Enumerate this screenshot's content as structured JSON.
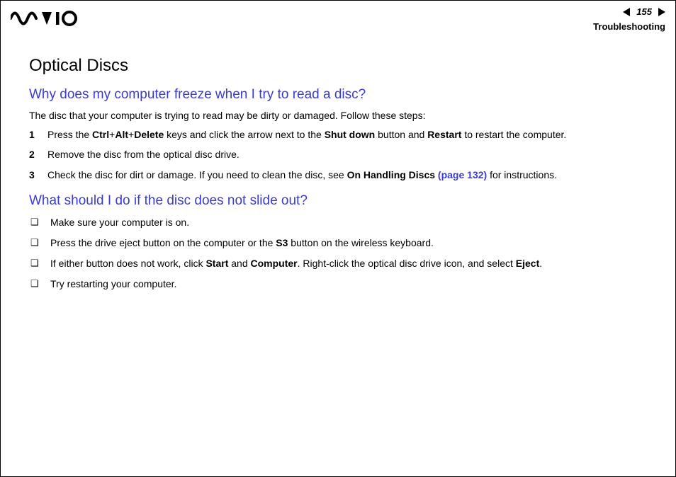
{
  "header": {
    "page_number": "155",
    "section": "Troubleshooting"
  },
  "content": {
    "title": "Optical Discs",
    "q1": {
      "heading": "Why does my computer freeze when I try to read a disc?",
      "intro": "The disc that your computer is trying to read may be dirty or damaged. Follow these steps:",
      "steps": [
        {
          "pre": "Press the ",
          "b1": "Ctrl",
          "mid1": "+",
          "b2": "Alt",
          "mid2": "+",
          "b3": "Delete",
          "mid3": " keys and click the arrow next to the ",
          "b4": "Shut down",
          "mid4": " button and ",
          "b5": "Restart",
          "post": " to restart the computer."
        },
        {
          "text": "Remove the disc from the optical disc drive."
        },
        {
          "pre": "Check the disc for dirt or damage. If you need to clean the disc, see ",
          "b1": "On Handling Discs",
          "link": " (page 132)",
          "post": " for instructions."
        }
      ]
    },
    "q2": {
      "heading": "What should I do if the disc does not slide out?",
      "items": [
        {
          "text": "Make sure your computer is on."
        },
        {
          "pre": "Press the drive eject button on the computer or the ",
          "b1": "S3",
          "post": " button on the wireless keyboard."
        },
        {
          "pre": "If either button does not work, click ",
          "b1": "Start",
          "mid1": " and ",
          "b2": "Computer",
          "mid2": ". Right-click the optical disc drive icon, and select ",
          "b3": "Eject",
          "post": "."
        },
        {
          "text": "Try restarting your computer."
        }
      ]
    }
  }
}
